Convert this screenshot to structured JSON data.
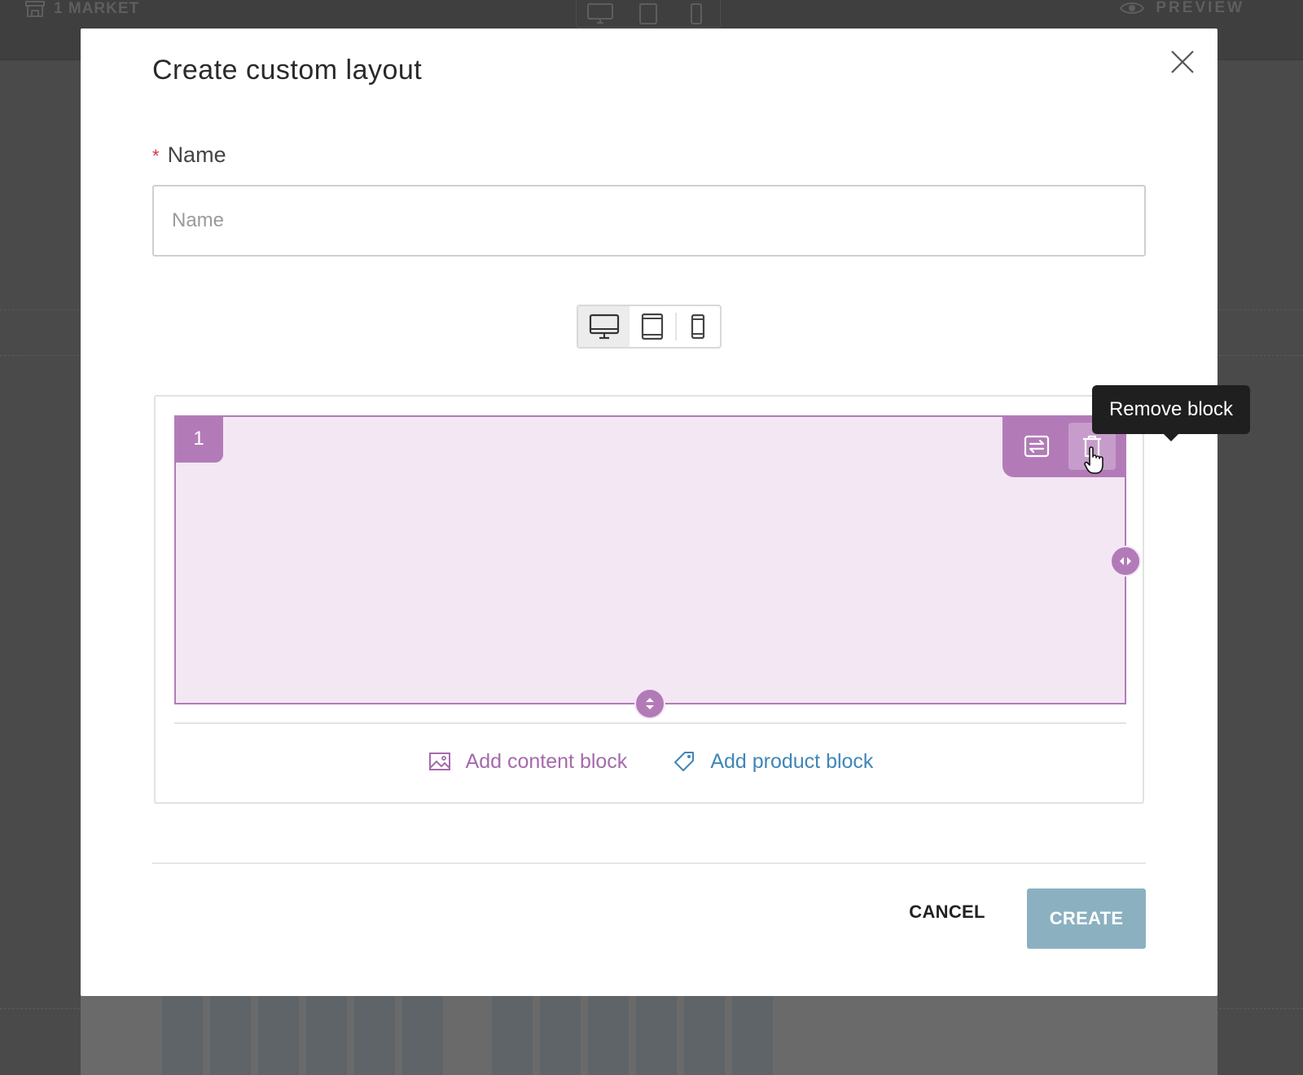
{
  "background": {
    "market_label": "1 MARKET",
    "preview_label": "PREVIEW"
  },
  "modal": {
    "title": "Create custom layout",
    "name_field": {
      "label": "Name",
      "required_mark": "*",
      "placeholder": "Name",
      "value": ""
    },
    "device_switch": {
      "options": [
        "desktop-icon",
        "tablet-icon",
        "mobile-icon"
      ],
      "selected": "desktop"
    },
    "block": {
      "number": "1",
      "tooltip": "Remove block",
      "color": "#b27bb8"
    },
    "actions": {
      "add_content_block": "Add content block",
      "add_product_block": "Add product block"
    },
    "footer": {
      "cancel_label": "CANCEL",
      "create_label": "CREATE"
    }
  }
}
